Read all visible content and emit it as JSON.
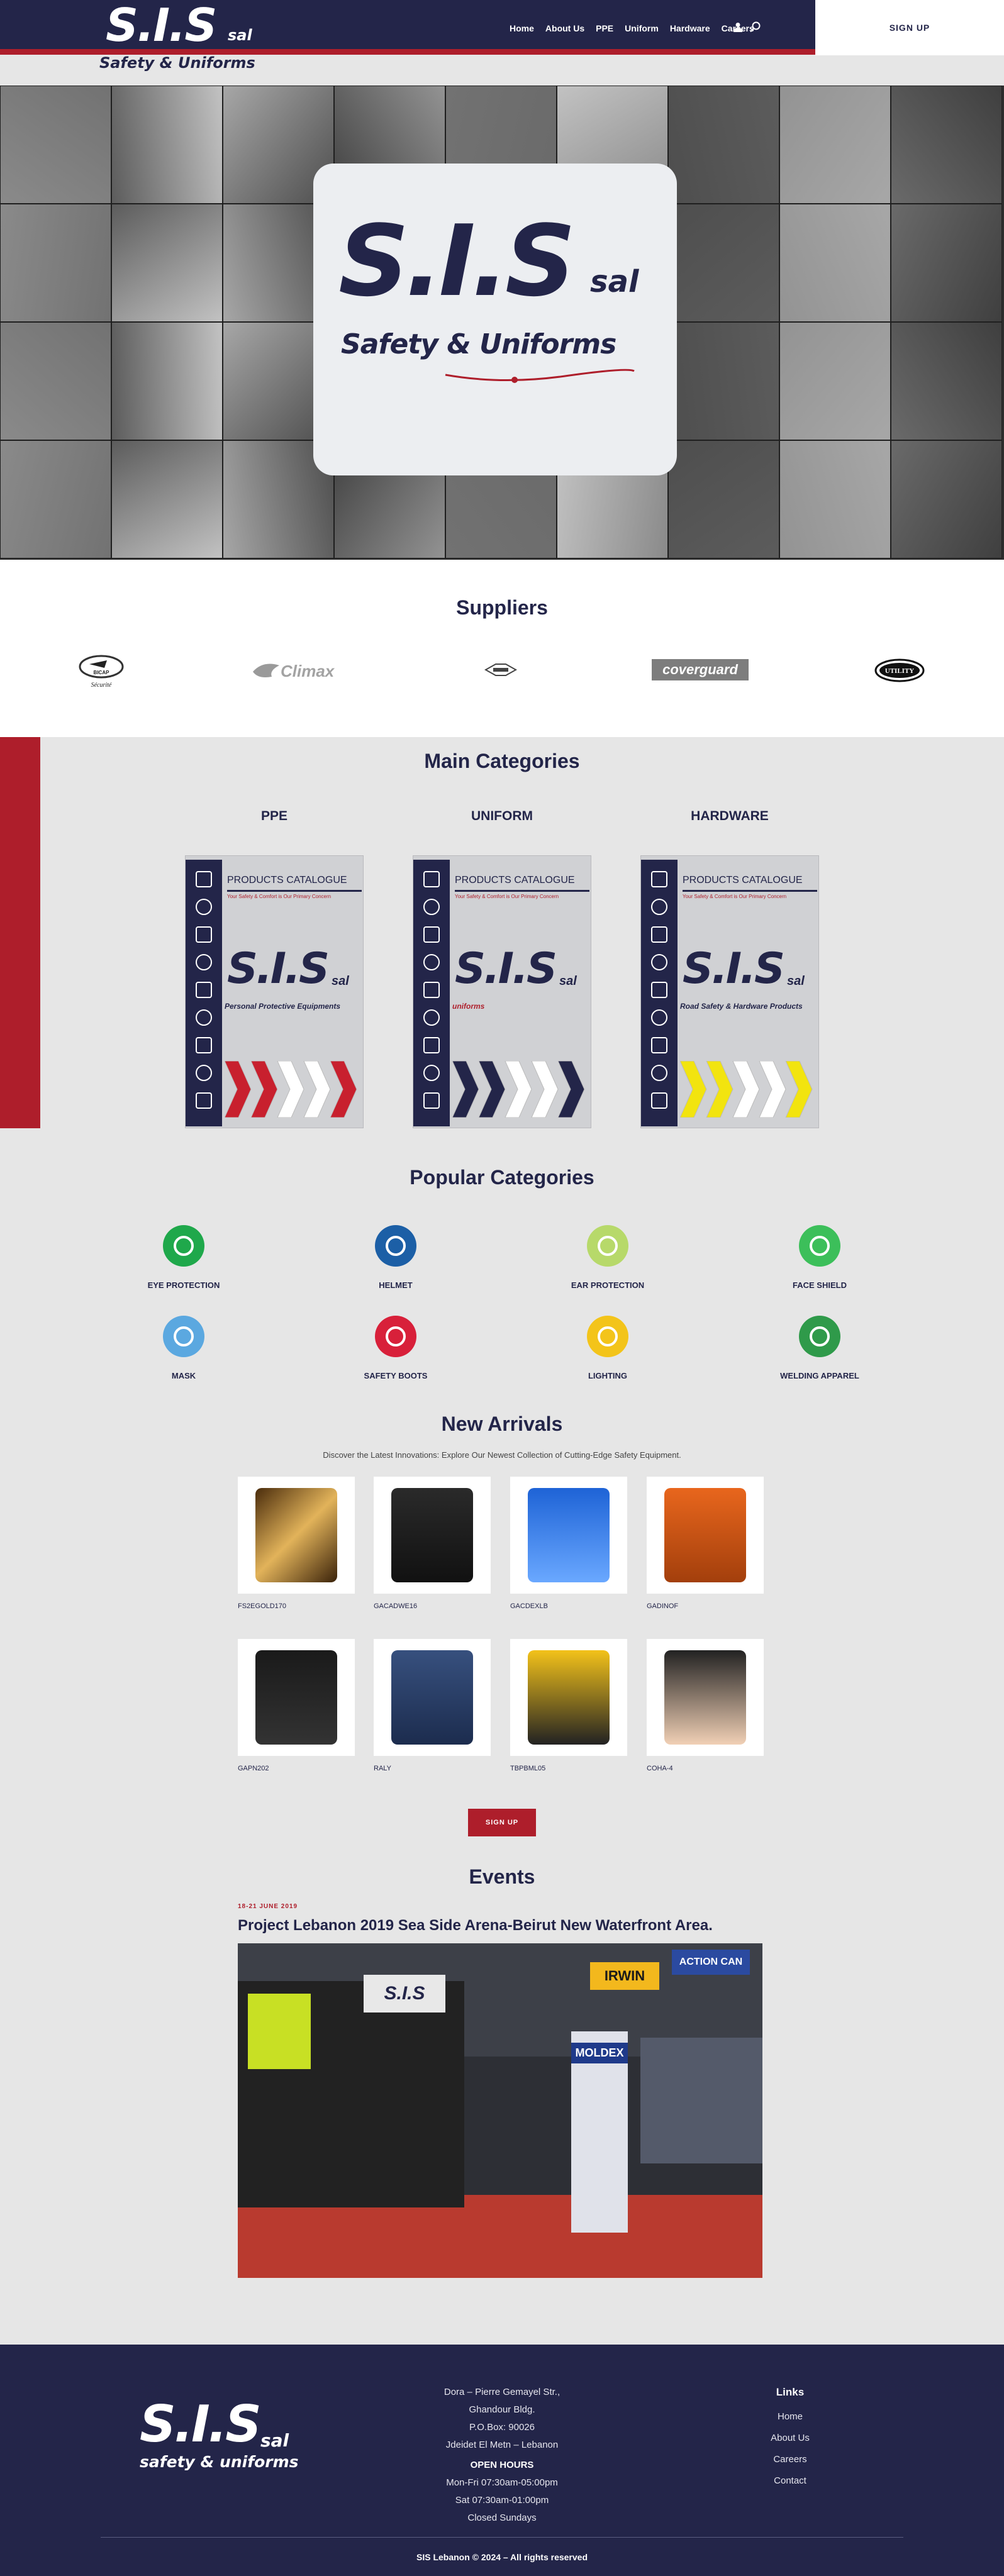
{
  "header": {
    "brand_main": "S.I.S",
    "brand_sub": "sal",
    "brand_tagline": "Safety & Uniforms",
    "nav": [
      "Home",
      "About Us",
      "PPE",
      "Uniform",
      "Hardware",
      "Careers"
    ],
    "signup_label": "SIGN UP",
    "colors": {
      "navy": "#232549",
      "red": "#ae1e2b"
    }
  },
  "hero": {
    "brand_main": "S.I.S",
    "brand_sub": "sal",
    "brand_tagline": "Safety & Uniforms"
  },
  "suppliers": {
    "title": "Suppliers",
    "logos": [
      "BICAP",
      "Climax",
      "",
      "coverguard",
      "UTILITY"
    ]
  },
  "main_categories": {
    "title": "Main Categories",
    "items": [
      {
        "title": "PPE",
        "header": "PRODUCTS CATALOGUE",
        "motto": "Your Safety & Comfort is Our Primary Concern",
        "brand": "S.I.S",
        "brand_sub": "sal",
        "desc": "Personal Protective Equipments",
        "chevron": "#c8202e"
      },
      {
        "title": "UNIFORM",
        "header": "PRODUCTS CATALOGUE",
        "motto": "Your Safety & Comfort is Our Primary Concern",
        "brand": "S.I.S",
        "brand_sub": "sal",
        "desc": "uniforms",
        "chevron": "#232549"
      },
      {
        "title": "HARDWARE",
        "header": "PRODUCTS CATALOGUE",
        "motto": "Your Safety & Comfort is Our Primary Concern",
        "brand": "S.I.S",
        "brand_sub": "sal",
        "desc": "Road Safety & Hardware Products",
        "chevron": "#f2e40f"
      }
    ]
  },
  "popular_categories": {
    "title": "Popular Categories",
    "items": [
      {
        "label": "EYE PROTECTION",
        "color": "#1fa84b"
      },
      {
        "label": "HELMET",
        "color": "#1c5fa6"
      },
      {
        "label": "EAR PROTECTION",
        "color": "#b7d96a"
      },
      {
        "label": "FACE SHIELD",
        "color": "#3cbf5a"
      },
      {
        "label": "MASK",
        "color": "#5ba8e0"
      },
      {
        "label": "SAFETY BOOTS",
        "color": "#d8203a"
      },
      {
        "label": "LIGHTING",
        "color": "#f3c41a"
      },
      {
        "label": "WELDING APPAREL",
        "color": "#2f9a4a"
      }
    ]
  },
  "new_arrivals": {
    "title": "New Arrivals",
    "subtitle": "Discover the Latest Innovations: Explore Our Newest Collection of Cutting-Edge Safety Equipment.",
    "items": [
      {
        "code": "FS2EGOLD170"
      },
      {
        "code": "GACADWE16"
      },
      {
        "code": "GACDEXLB"
      },
      {
        "code": "GADINOF"
      },
      {
        "code": "GAPN202"
      },
      {
        "code": "RALY"
      },
      {
        "code": "TBPBML05"
      },
      {
        "code": "COHA-4"
      }
    ],
    "signup_label": "SIGN UP"
  },
  "events": {
    "title": "Events",
    "date": "18-21 JUNE 2019",
    "headline": "Project Lebanon 2019 Sea Side Arena-Beirut New Waterfront Area.",
    "photo_signs": [
      "IRWIN",
      "ACTION CAN",
      "MOLDEX",
      "S.I.S"
    ]
  },
  "footer": {
    "brand_main": "S.I.S",
    "brand_sub": "sal",
    "brand_tagline": "safety & uniforms",
    "address": [
      "Dora – Pierre Gemayel Str.,",
      "Ghandour Bldg.",
      "P.O.Box: 90026",
      "Jdeidet El Metn – Lebanon"
    ],
    "hours_title": "OPEN HOURS",
    "hours": [
      "Mon-Fri 07:30am-05:00pm",
      "Sat 07:30am-01:00pm",
      "Closed Sundays"
    ],
    "links_title": "Links",
    "links": [
      "Home",
      "About Us",
      "Careers",
      "Contact"
    ],
    "copyright": "SIS Lebanon © 2024 – All rights reserved"
  }
}
